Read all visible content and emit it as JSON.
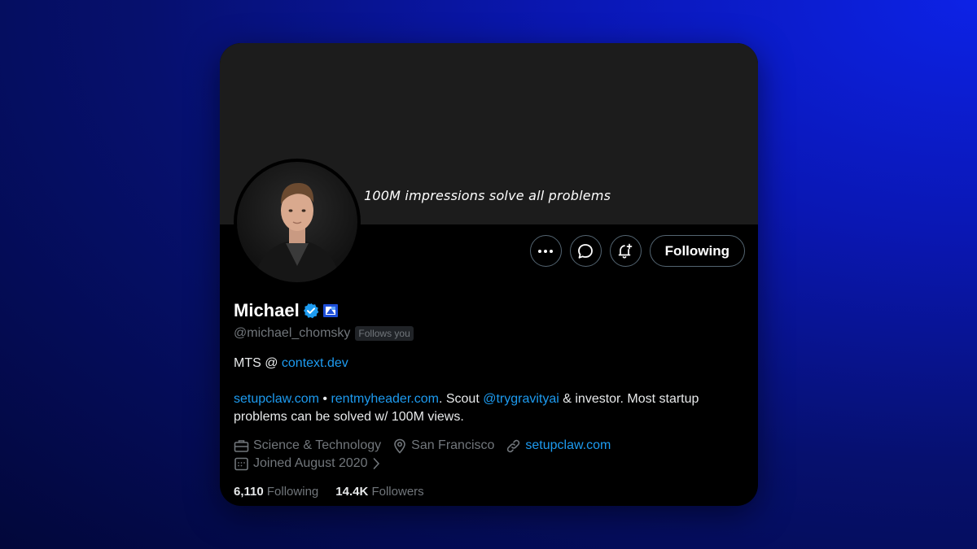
{
  "banner": {
    "text": "100M impressions solve all problems",
    "color": "#1c1c1c"
  },
  "profile": {
    "name": "Michael",
    "handle": "@michael_chomsky",
    "follows_you": "Follows you",
    "verified_color": "#1d9bf0"
  },
  "actions": {
    "more_icon": "more-icon",
    "message_icon": "message-icon",
    "notify_icon": "bell-plus-icon",
    "follow_label": "Following"
  },
  "bio": {
    "line1_prefix": "MTS @ ",
    "line1_link": "context.dev",
    "link1": "setupclaw.com",
    "sep": " • ",
    "link2": "rentmyheader.com",
    "text1": ". Scout ",
    "link3": "@trygravityai",
    "text2": " & investor. Most startup problems can be solved w/ 100M views."
  },
  "meta": {
    "category": "Science & Technology",
    "location": "San Francisco",
    "website": "setupclaw.com",
    "joined": "Joined August 2020"
  },
  "stats": {
    "following_count": "6,110",
    "following_label": "Following",
    "followers_count": "14.4K",
    "followers_label": "Followers"
  },
  "colors": {
    "link": "#1d9bf0",
    "muted": "#71767b",
    "text": "#e7e9ea"
  }
}
